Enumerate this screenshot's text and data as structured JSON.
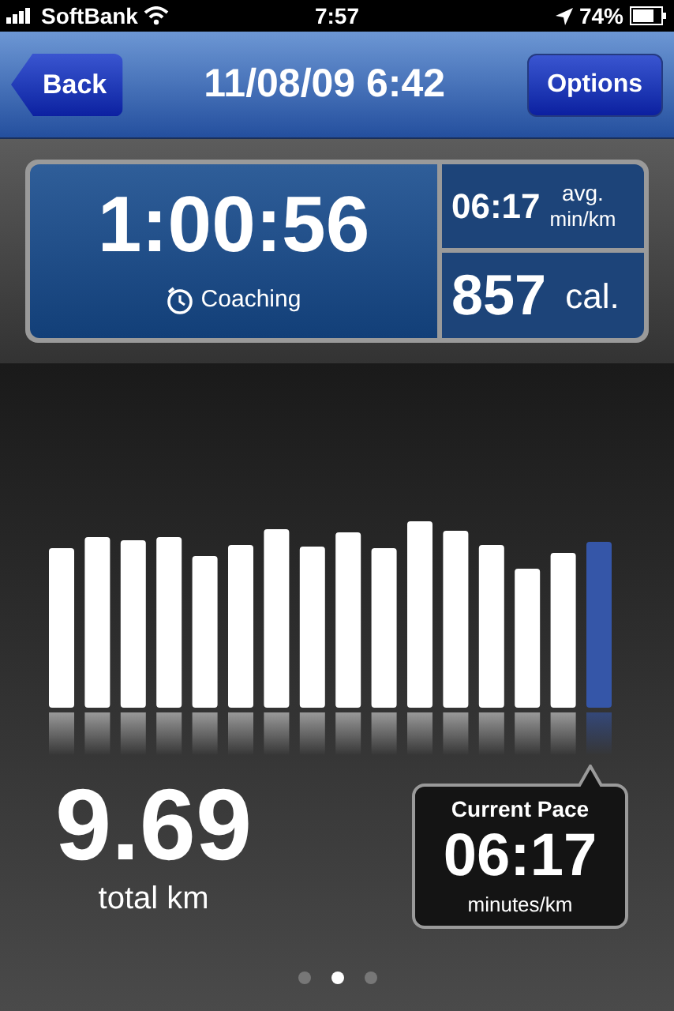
{
  "status_bar": {
    "carrier": "SoftBank",
    "time": "7:57",
    "battery": "74%"
  },
  "nav": {
    "back": "Back",
    "title": "11/08/09 6:42",
    "options": "Options"
  },
  "stats": {
    "duration": "1:00:56",
    "mode": "Coaching",
    "pace": "06:17",
    "pace_unit_1": "avg.",
    "pace_unit_2": "min/km",
    "calories": "857",
    "calories_unit": "cal."
  },
  "distance": {
    "value": "9.69",
    "label": "total km"
  },
  "current_pace": {
    "title": "Current Pace",
    "value": "06:17",
    "unit": "minutes/km"
  },
  "pages": [
    {
      "selected": false
    },
    {
      "selected": true
    },
    {
      "selected": false
    }
  ]
}
